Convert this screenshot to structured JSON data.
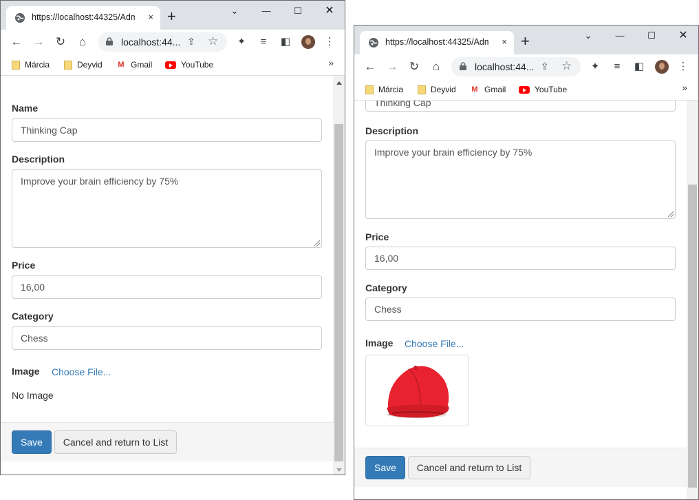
{
  "browser": {
    "tab_title": "https://localhost:44325/Admin/",
    "tab_close": "×",
    "new_tab": "+",
    "url": "localhost:44...",
    "bookmarks": [
      "Márcia",
      "Deyvid",
      "Gmail",
      "YouTube"
    ],
    "bookmarks_more": "»",
    "gmail_glyph": "M"
  },
  "form": {
    "name_label": "Name",
    "name_value": "Thinking Cap",
    "description_label": "Description",
    "description_value": "Improve your brain efficiency by 75%",
    "price_label": "Price",
    "price_value": "16,00",
    "category_label": "Category",
    "category_value": "Chess",
    "image_label": "Image",
    "choose_file": "Choose File...",
    "no_image": "No Image",
    "save_label": "Save",
    "cancel_label": "Cancel and return to List"
  },
  "right_window": {
    "partial_name_text": "Thinking Cap",
    "image_alt": "red cap product image"
  },
  "colors": {
    "primary": "#337ab7",
    "chrome_titlebar": "#dee1e6",
    "cap_red": "#e8232f"
  },
  "icons": [
    "globe-icon",
    "close-icon",
    "plus-icon",
    "minimize-icon",
    "maximize-icon",
    "window-close-icon",
    "back-arrow-icon",
    "forward-arrow-icon",
    "reload-icon",
    "home-icon",
    "lock-icon",
    "share-icon",
    "star-icon",
    "extensions-icon",
    "media-icon",
    "sidepanel-icon",
    "avatar",
    "kebab-menu-icon",
    "folder-icon",
    "gmail-icon",
    "youtube-icon",
    "chevron-double-right-icon"
  ]
}
